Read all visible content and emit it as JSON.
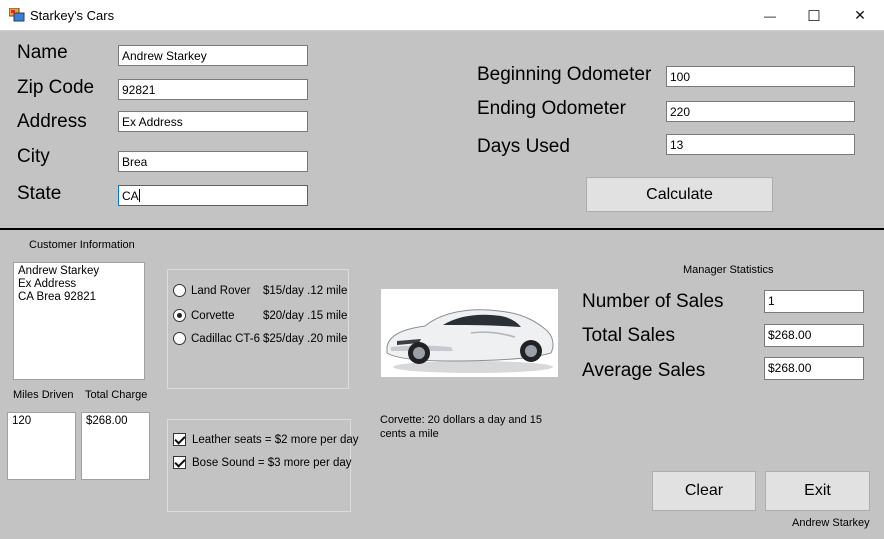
{
  "window": {
    "title": "Starkey's Cars",
    "minimize": "—",
    "maximize": "☐",
    "close": "✕"
  },
  "customer_form": {
    "name_label": "Name",
    "name_value": "Andrew Starkey",
    "zip_label": "Zip Code",
    "zip_value": "92821",
    "address_label": "Address",
    "address_value": "Ex Address",
    "city_label": "City",
    "city_value": "Brea",
    "state_label": "State",
    "state_value": "CA"
  },
  "trip_form": {
    "begin_label": "Beginning Odometer",
    "begin_value": "100",
    "end_label": "Ending Odometer",
    "end_value": "220",
    "days_label": "Days Used",
    "days_value": "13",
    "calculate_label": "Calculate"
  },
  "customer_info": {
    "heading": "Customer Information",
    "lines": [
      "Andrew Starkey",
      "Ex Address",
      "CA Brea 92821"
    ]
  },
  "miles": {
    "label": "Miles Driven",
    "value": "120"
  },
  "charge": {
    "label": "Total Charge",
    "value": "$268.00"
  },
  "cars": [
    {
      "name": "Land Rover",
      "rate": "$15/day .12 mile",
      "selected": false
    },
    {
      "name": "Corvette",
      "rate": "$20/day .15 mile",
      "selected": true
    },
    {
      "name": "Cadillac CT-6",
      "rate": "$25/day .20 mile",
      "selected": false
    }
  ],
  "options": [
    {
      "label": "Leather seats = $2 more per day",
      "checked": true
    },
    {
      "label": "Bose Sound = $3 more per day",
      "checked": true
    }
  ],
  "car_description": "Corvette: 20 dollars a day and 15 cents a mile",
  "manager": {
    "heading": "Manager Statistics",
    "num_sales_label": "Number of Sales",
    "num_sales_value": "1",
    "total_sales_label": "Total Sales",
    "total_sales_value": "$268.00",
    "avg_sales_label": "Average Sales",
    "avg_sales_value": "$268.00"
  },
  "buttons": {
    "clear": "Clear",
    "exit": "Exit"
  },
  "footer_name": "Andrew Starkey",
  "colors": {
    "form_bg": "#c3c3c3",
    "focus_border": "#0078d7",
    "button_bg": "#e1e1e1"
  }
}
